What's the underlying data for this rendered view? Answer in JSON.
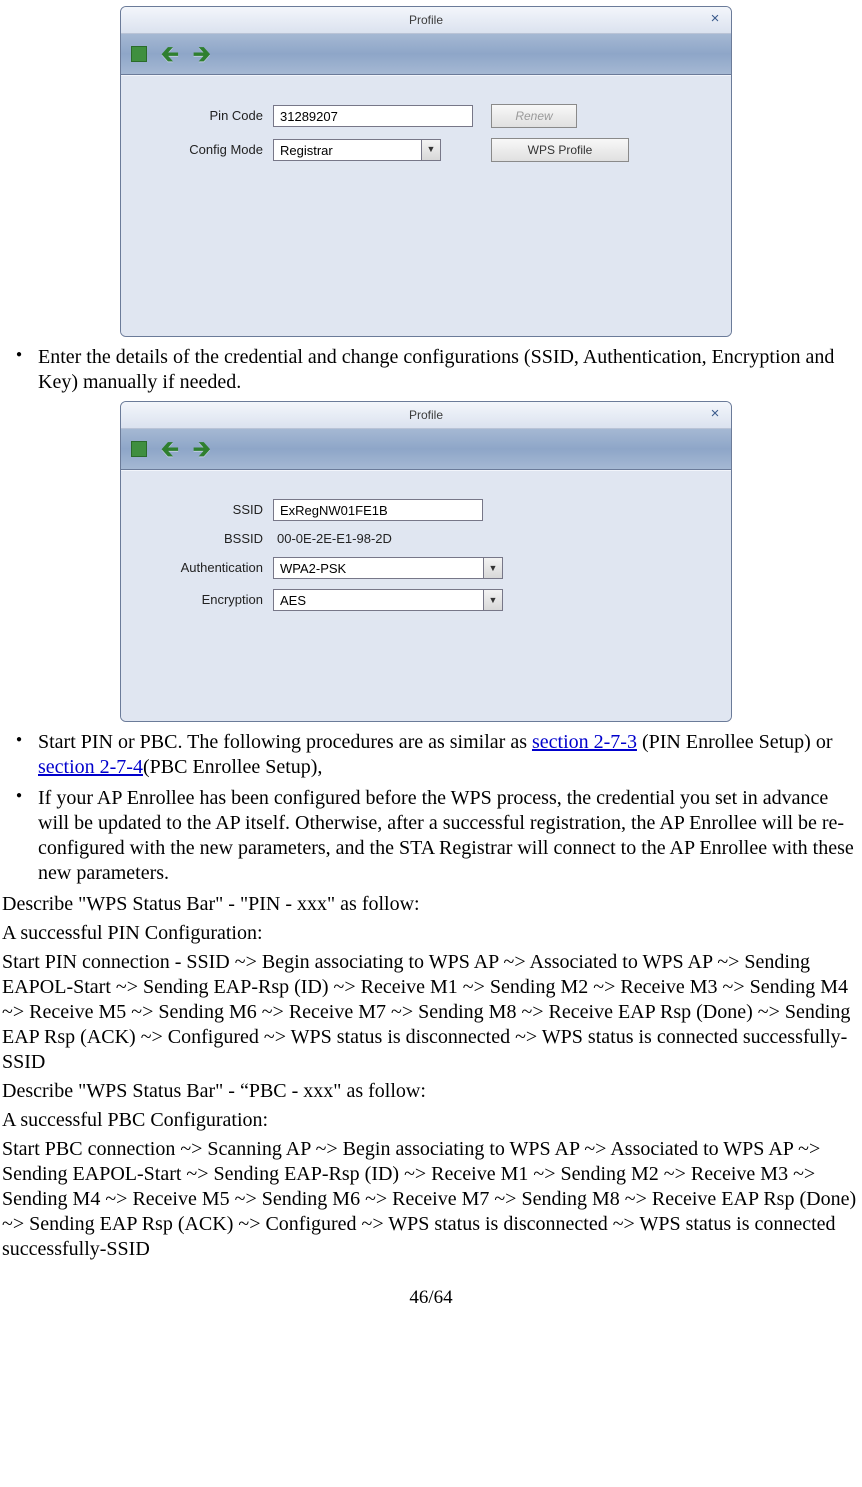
{
  "dialog1": {
    "title": "Profile",
    "pin_code": {
      "label": "Pin Code",
      "value": "31289207"
    },
    "config_mode": {
      "label": "Config Mode",
      "value": "Registrar"
    },
    "renew_btn": "Renew",
    "wps_btn": "WPS Profile"
  },
  "bullet1": "Enter the details of the credential and change configurations (SSID, Authentication, Encryption and Key) manually if needed.",
  "dialog2": {
    "title": "Profile",
    "ssid": {
      "label": "SSID",
      "value": "ExRegNW01FE1B"
    },
    "bssid": {
      "label": "BSSID",
      "value": "00-0E-2E-E1-98-2D"
    },
    "auth": {
      "label": "Authentication",
      "value": "WPA2-PSK"
    },
    "enc": {
      "label": "Encryption",
      "value": "AES"
    }
  },
  "bullet2_a": "Start PIN or PBC. The following procedures are as similar as ",
  "bullet2_link1": "section 2-7-3",
  "bullet2_b": " (PIN Enrollee Setup) or ",
  "bullet2_link2": "section 2-7-4",
  "bullet2_c": "(PBC Enrollee Setup),",
  "bullet3": "If your AP Enrollee has been configured before the WPS process, the credential you set in advance will be updated to the AP itself. Otherwise, after a successful registration, the AP Enrollee will be re-configured with the new parameters, and the STA Registrar will connect to the AP Enrollee with these new parameters.",
  "p1": "Describe \"WPS Status Bar\" - \"PIN - xxx\" as follow:",
  "p2": "A successful PIN Configuration:",
  "p3": "Start PIN connection - SSID ~> Begin associating to WPS AP ~> Associated to WPS AP ~> Sending EAPOL-Start ~> Sending EAP-Rsp (ID) ~> Receive M1 ~> Sending M2 ~> Receive M3 ~> Sending M4 ~> Receive M5 ~> Sending M6 ~> Receive M7 ~> Sending M8 ~> Receive EAP Rsp (Done) ~> Sending EAP Rsp (ACK) ~> Configured ~> WPS status is disconnected ~> WPS status is connected successfully-SSID",
  "p4": "Describe \"WPS Status Bar\" - “PBC - xxx\" as follow:",
  "p5": "A successful PBC Configuration:",
  "p6": "Start PBC connection ~> Scanning AP ~> Begin associating to WPS AP ~> Associated to WPS AP ~> Sending EAPOL-Start ~> Sending EAP-Rsp (ID) ~> Receive M1 ~> Sending M2 ~> Receive M3 ~> Sending M4 ~> Receive M5 ~> Sending M6 ~> Receive M7 ~> Sending M8 ~> Receive EAP Rsp (Done) ~> Sending EAP Rsp (ACK) ~> Configured ~> WPS status is disconnected ~> WPS status is connected successfully-SSID",
  "footer": "46/64"
}
